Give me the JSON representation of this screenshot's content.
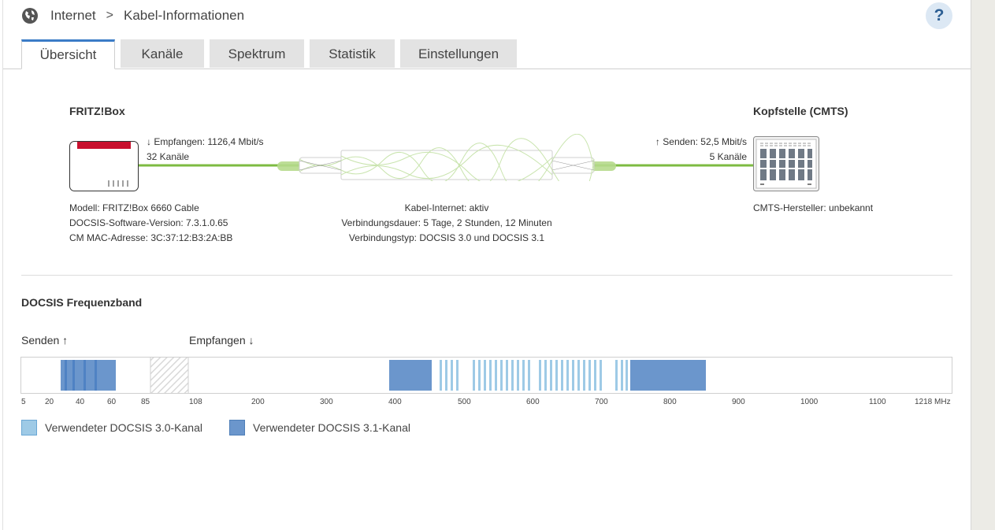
{
  "breadcrumb": {
    "section": "Internet",
    "separator": ">",
    "page": "Kabel-Informationen"
  },
  "help": {
    "label": "?"
  },
  "tabs": [
    {
      "label": "Übersicht",
      "active": true
    },
    {
      "label": "Kanäle"
    },
    {
      "label": "Spektrum"
    },
    {
      "label": "Statistik"
    },
    {
      "label": "Einstellungen"
    }
  ],
  "device": {
    "title": "FRITZ!Box",
    "model": "Modell: FRITZ!Box 6660 Cable",
    "docsis_version": "DOCSIS-Software-Version: 7.3.1.0.65",
    "mac": "CM MAC-Adresse: 3C:37:12:B3:2A:BB"
  },
  "downstream": {
    "arrow": "↓",
    "rate": "Empfangen: 1126,4 Mbit/s",
    "channels": "32 Kanäle"
  },
  "upstream": {
    "arrow": "↑",
    "rate": "Senden: 52,5 Mbit/s",
    "channels": "5 Kanäle"
  },
  "connection": {
    "status": "Kabel-Internet: aktiv",
    "duration": "Verbindungsdauer: 5 Tage, 2 Stunden, 12 Minuten",
    "type": "Verbindungstyp: DOCSIS 3.0 und DOCSIS 3.1"
  },
  "headend": {
    "title": "Kopfstelle (CMTS)",
    "manufacturer": "CMTS-Hersteller: unbekannt"
  },
  "band": {
    "title": "DOCSIS Frequenzband",
    "send_label": "Senden",
    "send_arrow": "↑",
    "receive_label": "Empfangen",
    "receive_arrow": "↓",
    "ticks": [
      "5",
      "20",
      "40",
      "60",
      "85",
      "108",
      "200",
      "300",
      "400",
      "500",
      "600",
      "700",
      "800",
      "900",
      "1000",
      "1100",
      "1218 MHz"
    ],
    "legend": {
      "docsis30": "Verwendeter DOCSIS 3.0-Kanal",
      "docsis31": "Verwendeter DOCSIS 3.1-Kanal"
    }
  },
  "colors": {
    "accent": "#3b7cc7",
    "docsis30": "#9ecae6",
    "docsis31": "#6b96cc",
    "cable_green": "#7dbb42",
    "router_red": "#c8102e"
  }
}
